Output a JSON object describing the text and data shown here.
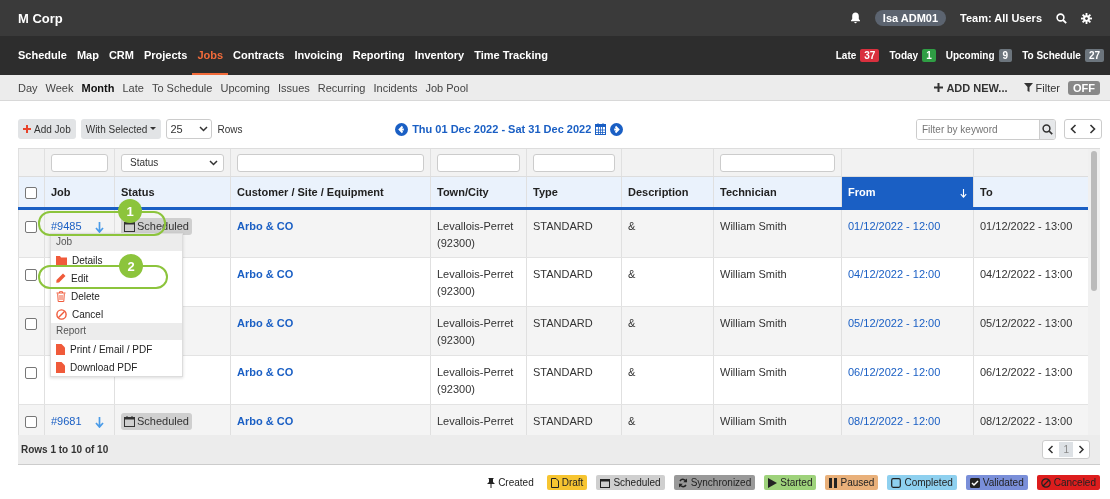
{
  "app": {
    "title": "M Corp",
    "user": "Isa ADM01",
    "team": "Team: All Users"
  },
  "nav": [
    {
      "label": "Schedule",
      "selected": false
    },
    {
      "label": "Map",
      "selected": false
    },
    {
      "label": "CRM",
      "selected": false
    },
    {
      "label": "Projects",
      "selected": false
    },
    {
      "label": "Jobs",
      "selected": true
    },
    {
      "label": "Contracts",
      "selected": false
    },
    {
      "label": "Invoicing",
      "selected": false
    },
    {
      "label": "Reporting",
      "selected": false
    },
    {
      "label": "Inventory",
      "selected": false
    },
    {
      "label": "Time Tracking",
      "selected": false
    }
  ],
  "counters": [
    {
      "label": "Late",
      "count": "37",
      "color": "#d9303e"
    },
    {
      "label": "Today",
      "count": "1",
      "color": "#2f9e44"
    },
    {
      "label": "Upcoming",
      "count": "9",
      "color": "#6c757d"
    },
    {
      "label": "To Schedule",
      "count": "27",
      "color": "#6c757d"
    }
  ],
  "subnav": [
    {
      "label": "Day",
      "selected": false
    },
    {
      "label": "Week",
      "selected": false
    },
    {
      "label": "Month",
      "selected": true
    },
    {
      "label": "Late",
      "selected": false
    },
    {
      "label": "To Schedule",
      "selected": false
    },
    {
      "label": "Upcoming",
      "selected": false
    },
    {
      "label": "Issues",
      "selected": false
    },
    {
      "label": "Recurring",
      "selected": false
    },
    {
      "label": "Incidents",
      "selected": false
    },
    {
      "label": "Job Pool",
      "selected": false
    }
  ],
  "add_new": "ADD NEW...",
  "filter": {
    "label": "Filter",
    "toggle": "OFF"
  },
  "toolbar": {
    "add_job": "Add Job",
    "with_selected": "With Selected",
    "rows_value": "25",
    "rows_label": "Rows",
    "date_range": "Thu 01 Dec 2022 - Sat 31 Dec 2022",
    "search_placeholder": "Filter by keyword"
  },
  "table": {
    "status_filter": "Status",
    "select_all_checked": false,
    "columns": [
      {
        "label": "Job",
        "sorted": false
      },
      {
        "label": "Status",
        "sorted": false
      },
      {
        "label": "Customer / Site / Equipment",
        "sorted": false
      },
      {
        "label": "Town/City",
        "sorted": false
      },
      {
        "label": "Type",
        "sorted": false
      },
      {
        "label": "Description",
        "sorted": false
      },
      {
        "label": "Technician",
        "sorted": false
      },
      {
        "label": "From",
        "sorted": true
      },
      {
        "label": "To",
        "sorted": false
      }
    ],
    "rows": [
      {
        "checked": false,
        "job": "#9485",
        "status": "Scheduled",
        "customer": "Arbo & CO",
        "town": "Levallois-Perret",
        "postcode": "(92300)",
        "type": "STANDARD",
        "description": "&",
        "technician": "William Smith",
        "from": "01/12/2022 - 12:00",
        "to": "01/12/2022 - 13:00"
      },
      {
        "checked": false,
        "customer": "Arbo & CO",
        "town": "Levallois-Perret",
        "postcode": "(92300)",
        "type": "STANDARD",
        "description": "&",
        "technician": "William Smith",
        "from": "04/12/2022 - 12:00",
        "to": "04/12/2022 - 13:00"
      },
      {
        "checked": false,
        "customer": "Arbo & CO",
        "town": "Levallois-Perret",
        "postcode": "(92300)",
        "type": "STANDARD",
        "description": "&",
        "technician": "William Smith",
        "from": "05/12/2022 - 12:00",
        "to": "05/12/2022 - 13:00"
      },
      {
        "checked": false,
        "customer": "Arbo & CO",
        "town": "Levallois-Perret",
        "postcode": "(92300)",
        "type": "STANDARD",
        "description": "&",
        "technician": "William Smith",
        "from": "06/12/2022 - 12:00",
        "to": "06/12/2022 - 13:00"
      },
      {
        "checked": false,
        "job": "#9681",
        "status": "Scheduled",
        "customer": "Arbo & CO",
        "town": "Levallois-Perret",
        "type": "STANDARD",
        "description": "&",
        "technician": "William Smith",
        "from": "08/12/2022 - 12:00",
        "to": "08/12/2022 - 13:00"
      }
    ],
    "footer": "Rows 1 to 10 of 10",
    "page": "1"
  },
  "menu": [
    {
      "kind": "header",
      "label": "Job"
    },
    {
      "kind": "folder",
      "label": "Details"
    },
    {
      "kind": "pencil",
      "label": "Edit"
    },
    {
      "kind": "trash",
      "label": "Delete"
    },
    {
      "kind": "ban",
      "label": "Cancel"
    },
    {
      "kind": "header",
      "label": "Report"
    },
    {
      "kind": "file",
      "label": "Print / Email / PDF"
    },
    {
      "kind": "file",
      "label": "Download PDF"
    }
  ],
  "callouts": [
    {
      "number": "1"
    },
    {
      "number": "2"
    }
  ],
  "legend": [
    {
      "kind": "pin",
      "label": "Created"
    },
    {
      "kind": "file",
      "label": "Draft",
      "color": "#f7c531"
    },
    {
      "kind": "calendar",
      "label": "Scheduled",
      "color": "#cfcfcf"
    },
    {
      "kind": "sync",
      "label": "Synchronized",
      "color": "#999999"
    },
    {
      "kind": "play",
      "label": "Started",
      "color": "#9ed27b"
    },
    {
      "kind": "pause",
      "label": "Paused",
      "color": "#e9b07a"
    },
    {
      "kind": "square",
      "label": "Completed",
      "color": "#8ed0ef"
    },
    {
      "kind": "check",
      "label": "Validated",
      "color": "#7a8fd9"
    },
    {
      "kind": "ban",
      "label": "Canceled",
      "color": "#dd1d1d"
    }
  ]
}
